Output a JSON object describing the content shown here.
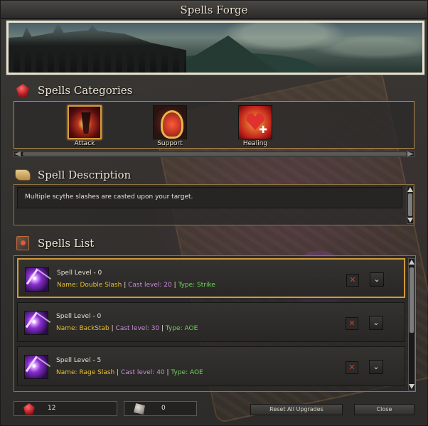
{
  "window": {
    "title": "Spells Forge"
  },
  "categories_section": {
    "title": "Spells Categories",
    "items": [
      {
        "label": "Attack",
        "active": true
      },
      {
        "label": "Support",
        "active": false
      },
      {
        "label": "Healing",
        "active": false
      }
    ]
  },
  "description_section": {
    "title": "Spell Description",
    "text": "Multiple scythe slashes are casted upon your target."
  },
  "spells_section": {
    "title": "Spells List",
    "spells": [
      {
        "level": "Spell Level - 0",
        "name": "Name: Double Slash",
        "sep1": " | ",
        "cast": "Cast level: 20",
        "sep2": " | ",
        "type": "Type: Strike",
        "selected": true,
        "delete_glyph": "✕",
        "expand_glyph": "⌄"
      },
      {
        "level": "Spell Level - 0",
        "name": "Name: BackStab",
        "sep1": " | ",
        "cast": "Cast level: 30",
        "sep2": " | ",
        "type": "Type: AOE",
        "selected": false,
        "delete_glyph": "✕",
        "expand_glyph": "⌄"
      },
      {
        "level": "Spell Level - 5",
        "name": "Name: Rage Slash",
        "sep1": " | ",
        "cast": "Cast level: 40",
        "sep2": " | ",
        "type": "Type: AOE",
        "selected": false,
        "delete_glyph": "✕",
        "expand_glyph": "⌄"
      }
    ]
  },
  "footer": {
    "gems": "12",
    "coins": "0",
    "reset_label": "Reset All Upgrades",
    "close_label": "Close"
  },
  "colors": {
    "accent_gold": "#b0894b",
    "name_color": "#e8bf2e",
    "cast_color": "#c98ad8",
    "type_color": "#6fd15c"
  }
}
